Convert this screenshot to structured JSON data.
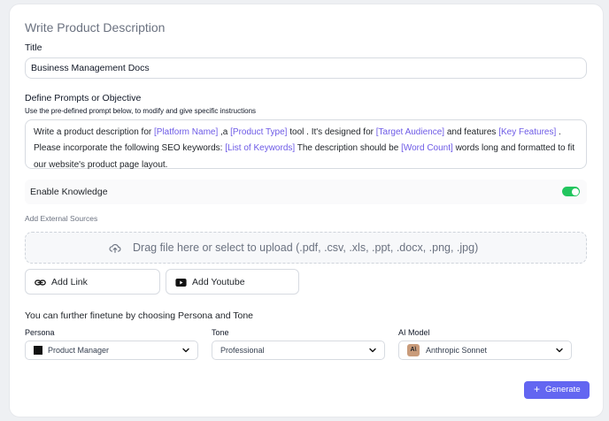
{
  "header": {
    "title": "Write Product Description"
  },
  "title_field": {
    "label": "Title",
    "value": "Business Management Docs"
  },
  "prompts": {
    "label": "Define Prompts or Objective",
    "hint": "Use the pre-defined prompt below, to modify and give specific instructions",
    "parts": {
      "t1": "Write a product description for ",
      "p1": "[Platform Name]",
      "t2": " ,a ",
      "p2": "[Product Type]",
      "t3": " tool . It's designed for ",
      "p3": "[Target Audience]",
      "t4": " and features ",
      "p4": "[Key Features]",
      "t5": " . Please incorporate the following SEO keywords: ",
      "p5": "[List of Keywords]",
      "t6": " The description should be ",
      "p6": "[Word Count]",
      "t7": " words long and formatted to fit our website's product page layout."
    }
  },
  "knowledge": {
    "label": "Enable Knowledge",
    "enabled": true
  },
  "external_sources": {
    "label": "Add External Sources",
    "dropzone_text": "Drag file here or select to upload (.pdf, .csv, .xls, .ppt, .docx, .png, .jpg)",
    "add_link_label": "Add Link",
    "add_youtube_label": "Add Youtube"
  },
  "finetune": {
    "heading": "You can further finetune by choosing Persona and Tone",
    "persona": {
      "label": "Persona",
      "value": "Product Manager"
    },
    "tone": {
      "label": "Tone",
      "value": "Professional"
    },
    "model": {
      "label": "AI Model",
      "value": "Anthropic Sonnet",
      "badge": "A\\"
    }
  },
  "actions": {
    "generate_label": "Generate"
  },
  "colors": {
    "accent": "#6366f1",
    "placeholder": "#6d5ae6",
    "toggle_on": "#22c55e"
  },
  "icons": [
    "upload-icon",
    "link-icon",
    "youtube-icon",
    "chevron-down-icon",
    "plus-icon"
  ]
}
